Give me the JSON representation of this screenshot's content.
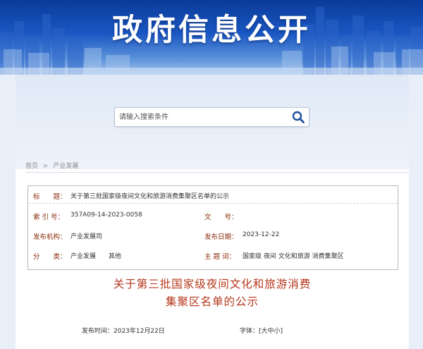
{
  "banner": {
    "title": "政府信息公开"
  },
  "search": {
    "placeholder": "请输入搜索条件",
    "icon": "search-icon"
  },
  "breadcrumb": {
    "items": [
      "首页",
      "产业发展"
    ],
    "separator": ">"
  },
  "meta": {
    "title_label": "标　　题：",
    "title_value": "关于第三批国家级夜间文化和旅游消费集聚区名单的公示",
    "index_label": "索 引 号：",
    "index_value": "357A09-14-2023-0058",
    "docno_label": "文　　号：",
    "docno_value": "",
    "org_label": "发布机构：",
    "org_value": "产业发展司",
    "date_label": "发布日期：",
    "date_value": "2023-12-22",
    "category_label": "分　　类：",
    "category_value": "产业发展　　其他",
    "subject_label": "主 题 词：",
    "subject_value": "国家级 夜间 文化和旅游 消费集聚区"
  },
  "article": {
    "title_line1": "关于第三批国家级夜间文化和旅游消费",
    "title_line2": "集聚区名单的公示",
    "pubtime": "发布时间：2023年12月22日",
    "fontsize": "字体：[大中小]"
  },
  "colors": {
    "accent": "#b5361b",
    "label": "#8a2b0b",
    "banner": "#1a57c2"
  }
}
